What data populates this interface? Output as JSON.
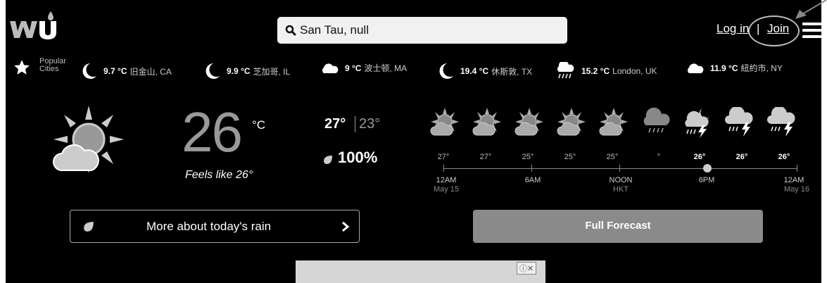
{
  "header": {
    "search_text": "San Tau, null",
    "login": "Log in",
    "separator": "|",
    "join": "Join"
  },
  "popular": {
    "label_line1": "Popular",
    "label_line2": "Cities",
    "cities": [
      {
        "temp": "9.7 °C",
        "name": "旧金山, CA",
        "icon": "moon-icon"
      },
      {
        "temp": "9.9 °C",
        "name": "芝加哥, IL",
        "icon": "moon-icon"
      },
      {
        "temp": "9 °C",
        "name": "波士顿, MA",
        "icon": "cloud-icon"
      },
      {
        "temp": "19.4 °C",
        "name": "休斯敦, TX",
        "icon": "moon-icon"
      },
      {
        "temp": "15.2 °C",
        "name": "London, UK",
        "icon": "rain-cloud-icon"
      },
      {
        "temp": "11.9 °C",
        "name": "紐約市, NY",
        "icon": "cloud-icon"
      }
    ]
  },
  "current": {
    "temp": "26",
    "unit": "°C",
    "feels_like": "Feels like 26°",
    "high": "27°",
    "low": "23°",
    "rain_chance": "100%"
  },
  "hourly": {
    "temps": [
      "27°",
      "27°",
      "25°",
      "25°",
      "25°",
      "°",
      "26°",
      "26°",
      "26°"
    ],
    "icons": [
      "partly-sunny-icon",
      "partly-sunny-icon",
      "partly-sunny-icon",
      "partly-sunny-icon",
      "partly-sunny-icon",
      "rain-cloud-icon",
      "night-thunderstorm-icon",
      "thunderstorm-icon",
      "thunderstorm-icon"
    ],
    "labels": [
      {
        "time": "12AM",
        "sub": "May 15"
      },
      {
        "time": "6AM",
        "sub": ""
      },
      {
        "time": "NOON",
        "sub": "HKT"
      },
      {
        "time": "6PM",
        "sub": ""
      },
      {
        "time": "12AM",
        "sub": "May 16"
      }
    ]
  },
  "buttons": {
    "rain": "More about today's rain",
    "full": "Full Forecast"
  },
  "ad": {
    "badge": "ⓘ✕"
  },
  "colors": {
    "background": "#000000",
    "button_gray": "#8a8a8a",
    "search_bg": "#f1f1f1"
  }
}
